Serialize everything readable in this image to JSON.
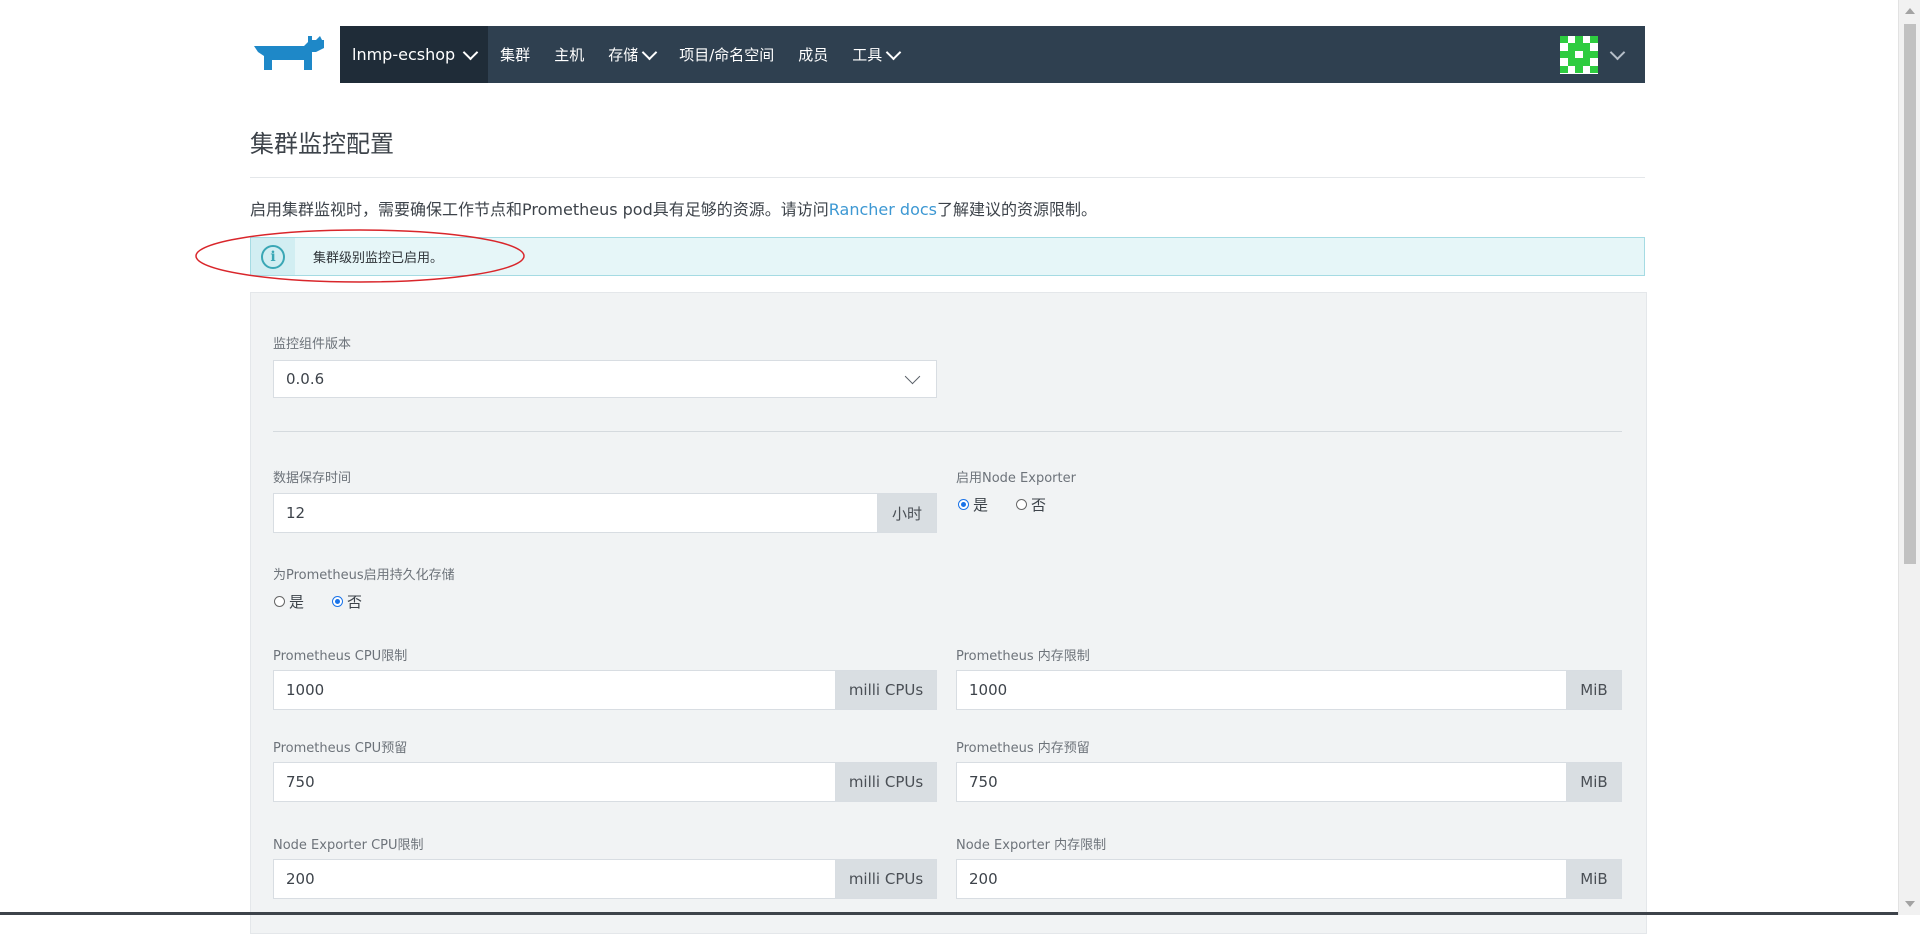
{
  "header": {
    "logo_icon": "rancher-cow-logo",
    "project": "lnmp-ecshop",
    "nav": [
      {
        "label": "集群",
        "dropdown": false
      },
      {
        "label": "主机",
        "dropdown": false
      },
      {
        "label": "存储",
        "dropdown": true
      },
      {
        "label": "项目/命名空间",
        "dropdown": false
      },
      {
        "label": "成员",
        "dropdown": false
      },
      {
        "label": "工具",
        "dropdown": true
      }
    ],
    "avatar_icon": "identicon-avatar",
    "colors": {
      "nav_bg": "#2f4050",
      "project_bg": "#1f2c38",
      "avatar": "#2ecc40"
    }
  },
  "page": {
    "title": "集群监控配置",
    "intro_before": "启用集群监视时，需要确保工作节点和Prometheus pod具有足够的资源。请访问",
    "intro_link": "Rancher docs",
    "intro_after": "了解建议的资源限制。"
  },
  "banner": {
    "icon": "info-icon",
    "icon_glyph": "i",
    "text": "集群级别监控已启用。"
  },
  "form": {
    "version": {
      "label": "监控组件版本",
      "value": "0.0.6"
    },
    "retention": {
      "label": "数据保存时间",
      "value": "12",
      "unit": "小时"
    },
    "node_exporter": {
      "label": "启用Node Exporter",
      "options": [
        "是",
        "否"
      ],
      "selected": "是"
    },
    "persistent": {
      "label": "为Prometheus启用持久化存储",
      "options": [
        "是",
        "否"
      ],
      "selected": "否"
    },
    "prom_cpu_limit": {
      "label": "Prometheus CPU限制",
      "value": "1000",
      "unit": "milli CPUs"
    },
    "prom_mem_limit": {
      "label": "Prometheus 内存限制",
      "value": "1000",
      "unit": "MiB"
    },
    "prom_cpu_reserve": {
      "label": "Prometheus CPU预留",
      "value": "750",
      "unit": "milli CPUs"
    },
    "prom_mem_reserve": {
      "label": "Prometheus 内存预留",
      "value": "750",
      "unit": "MiB"
    },
    "ne_cpu_limit": {
      "label": "Node Exporter CPU限制",
      "value": "200",
      "unit": "milli CPUs"
    },
    "ne_mem_limit": {
      "label": "Node Exporter 内存限制",
      "value": "200",
      "unit": "MiB"
    }
  }
}
